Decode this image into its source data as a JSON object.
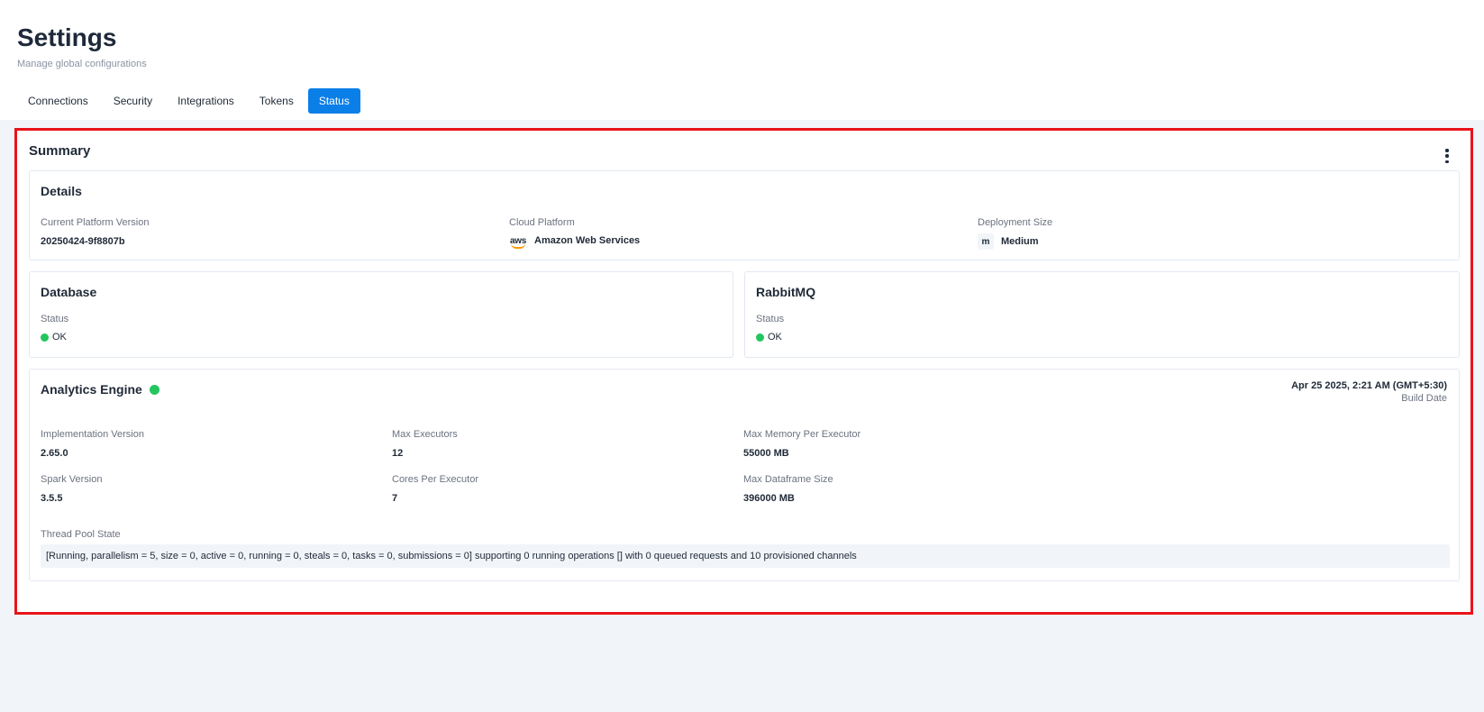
{
  "header": {
    "title": "Settings",
    "subtitle": "Manage global configurations"
  },
  "tabs": [
    {
      "label": "Connections",
      "active": false
    },
    {
      "label": "Security",
      "active": false
    },
    {
      "label": "Integrations",
      "active": false
    },
    {
      "label": "Tokens",
      "active": false
    },
    {
      "label": "Status",
      "active": true
    }
  ],
  "colors": {
    "accent": "#0b7fe8",
    "highlight_border": "#e8141a",
    "status_ok": "#22c55e",
    "background": "#f1f5f9"
  },
  "summary": {
    "title": "Summary",
    "menu_icon": "kebab-vertical-icon",
    "details": {
      "title": "Details",
      "platform_version_label": "Current Platform Version",
      "platform_version_value": "20250424-9f8807b",
      "cloud_label": "Cloud Platform",
      "cloud_icon": "aws-logo-icon",
      "cloud_logo_text": "aws",
      "cloud_value": "Amazon Web Services",
      "size_label": "Deployment Size",
      "size_badge": "m",
      "size_value": "Medium"
    },
    "database": {
      "title": "Database",
      "status_label": "Status",
      "status_value": "OK"
    },
    "rabbitmq": {
      "title": "RabbitMQ",
      "status_label": "Status",
      "status_value": "OK"
    },
    "analytics": {
      "title": "Analytics Engine",
      "build_date": "Apr 25 2025, 2:21 AM (GMT+5:30)",
      "build_date_label": "Build Date",
      "impl_version_label": "Implementation Version",
      "impl_version_value": "2.65.0",
      "max_executors_label": "Max Executors",
      "max_executors_value": "12",
      "max_memory_label": "Max Memory Per Executor",
      "max_memory_value": "55000 MB",
      "spark_version_label": "Spark Version",
      "spark_version_value": "3.5.5",
      "cores_label": "Cores Per Executor",
      "cores_value": "7",
      "max_df_label": "Max Dataframe Size",
      "max_df_value": "396000 MB",
      "thread_pool_label": "Thread Pool State",
      "thread_pool_value": "[Running, parallelism = 5, size = 0, active = 0, running = 0, steals = 0, tasks = 0, submissions = 0] supporting 0 running operations [] with 0 queued requests and 10 provisioned channels"
    }
  }
}
